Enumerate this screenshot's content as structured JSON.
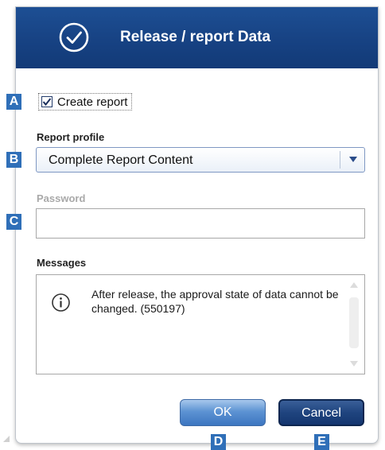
{
  "dialog": {
    "title": "Release / report Data",
    "title_icon": "check-circle-icon"
  },
  "markers": {
    "a": "A",
    "b": "B",
    "c": "C",
    "d": "D",
    "e": "E"
  },
  "create_report": {
    "label": "Create report",
    "checked": true
  },
  "report_profile": {
    "label": "Report profile",
    "value": "Complete Report Content"
  },
  "password": {
    "label": "Password",
    "value": "",
    "enabled": false
  },
  "messages": {
    "label": "Messages",
    "icon": "info-icon",
    "items": [
      {
        "text": "After release, the approval state of data cannot be changed. (550197)"
      }
    ]
  },
  "buttons": {
    "ok": "OK",
    "cancel": "Cancel"
  },
  "colors": {
    "title_bar": "#174283",
    "marker": "#2f6fb8",
    "ok_button": "#5d93d3",
    "cancel_button": "#1f447f"
  }
}
